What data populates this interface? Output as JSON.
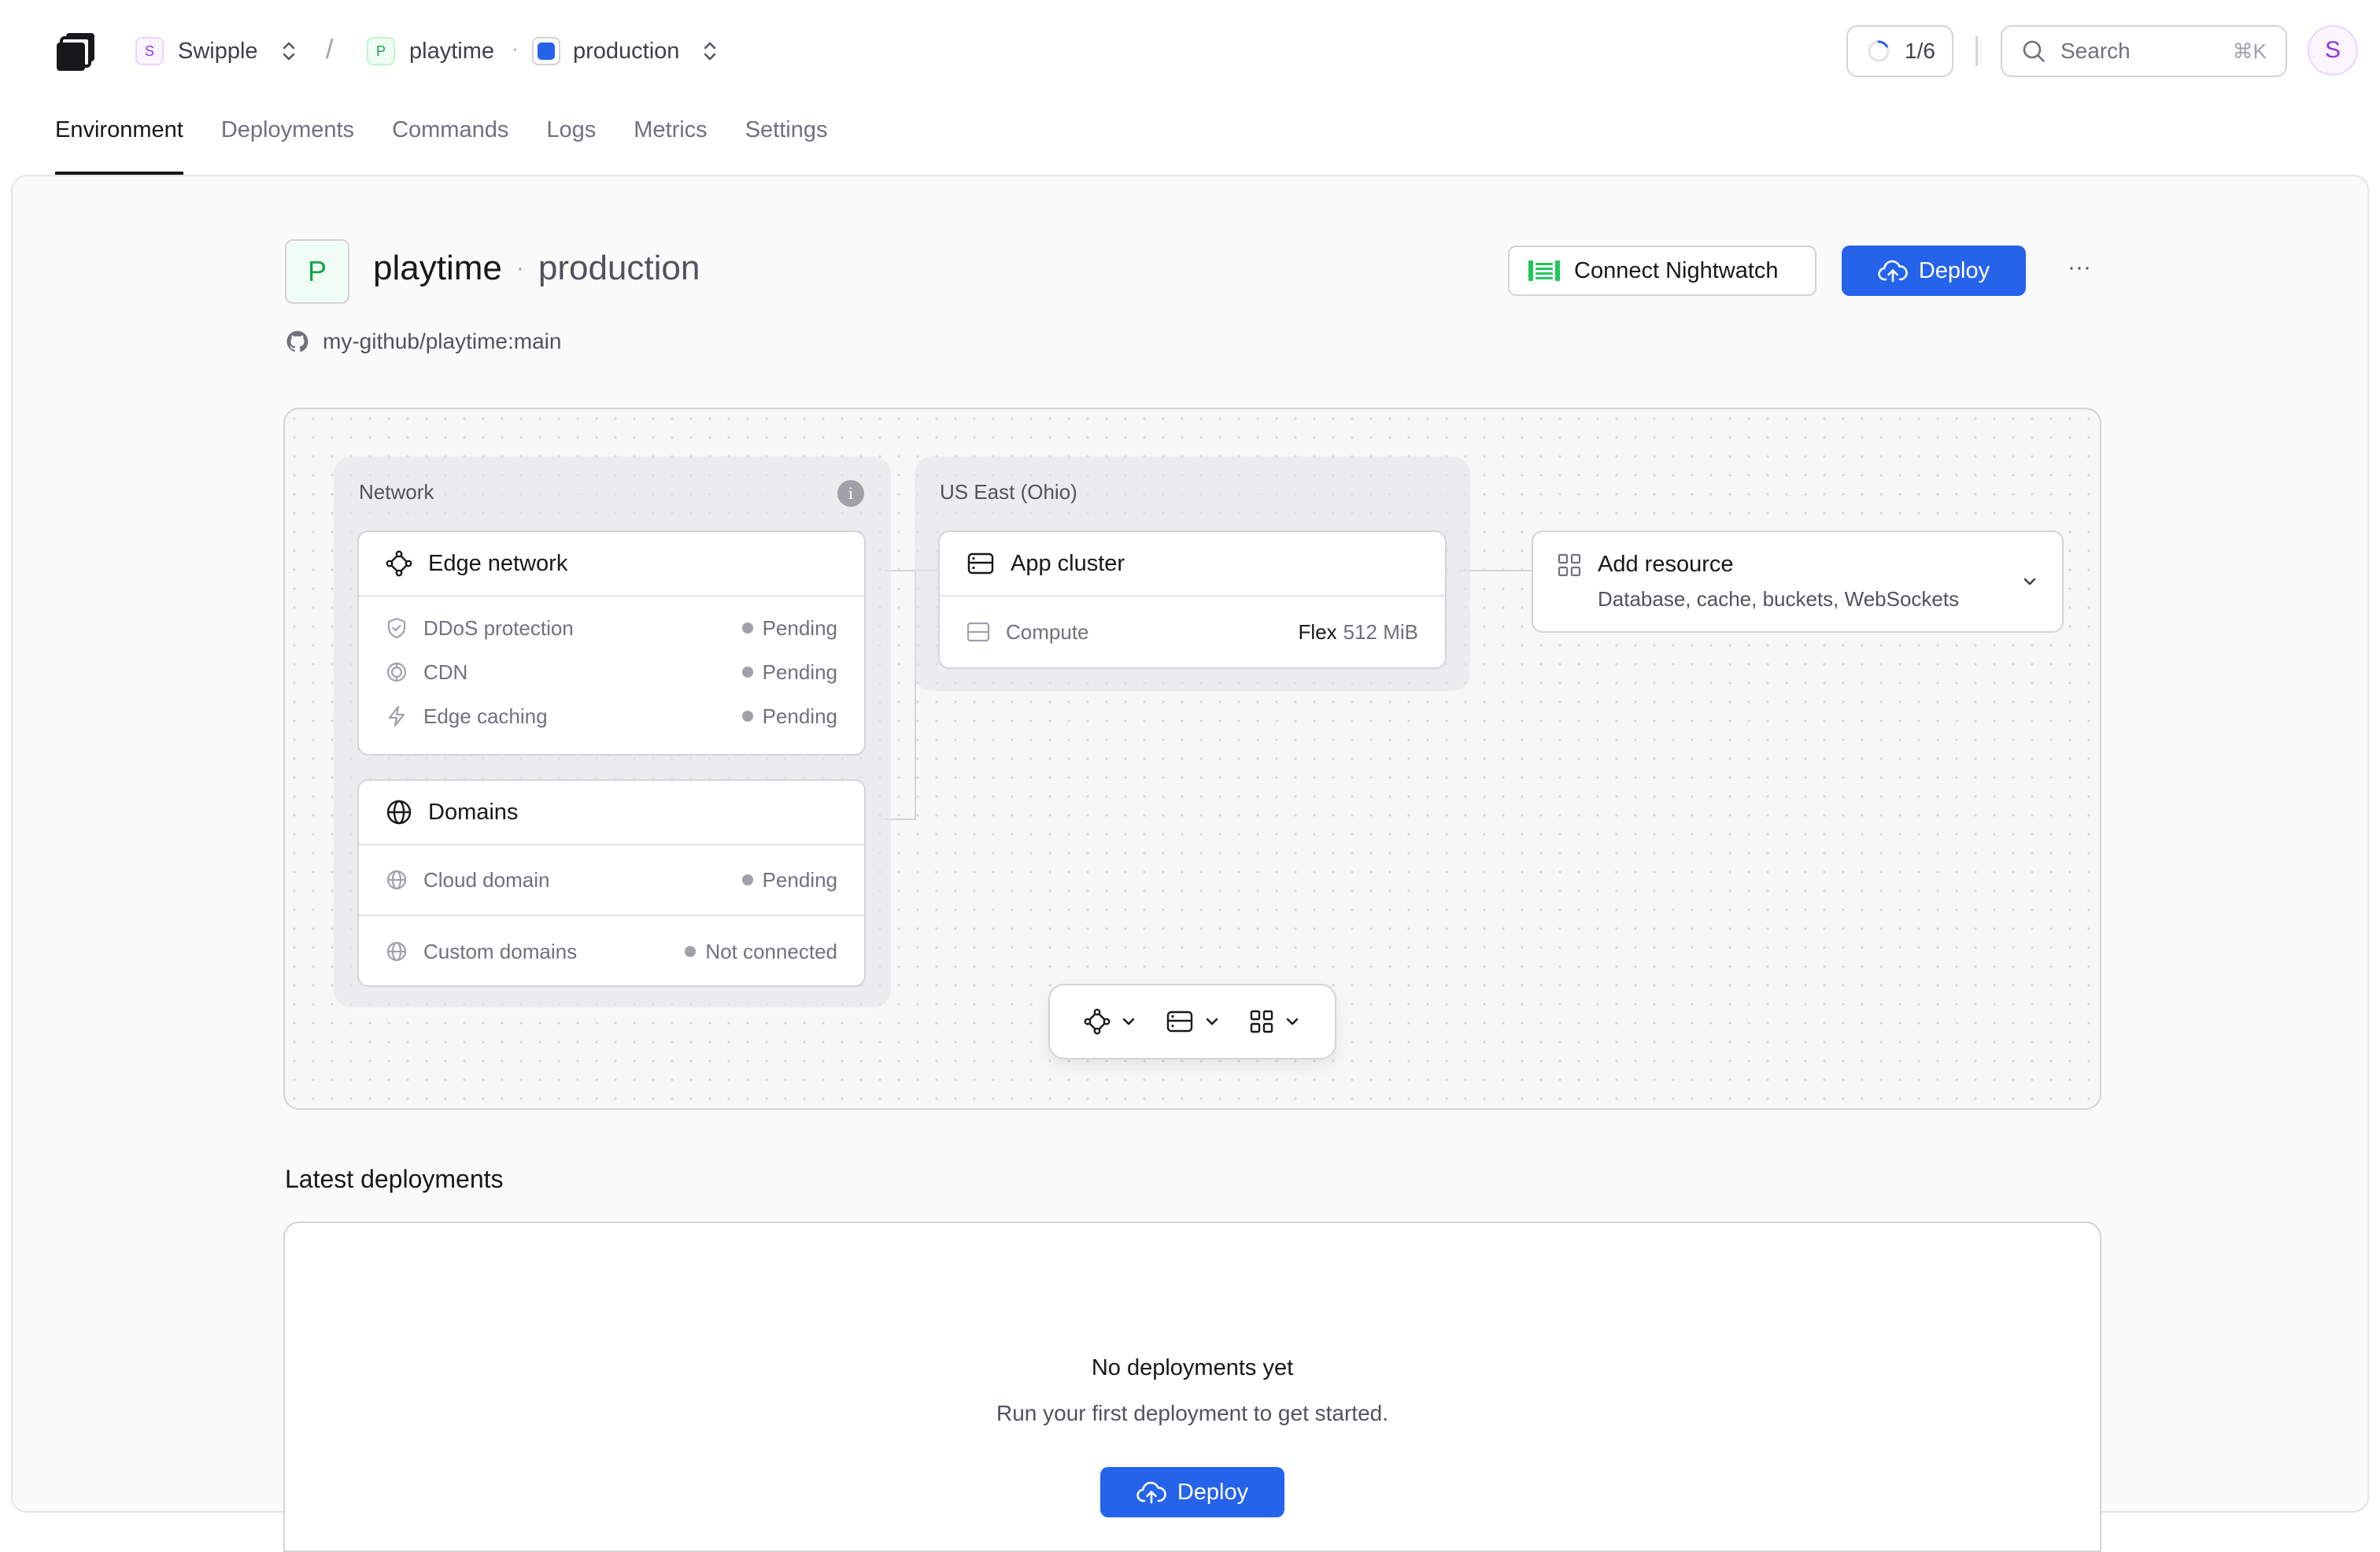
{
  "header": {
    "team": {
      "initial": "S",
      "name": "Swipple"
    },
    "separator": "/",
    "project": {
      "initial": "P",
      "name": "playtime"
    },
    "dot": "·",
    "environment": {
      "name": "production"
    },
    "progress": {
      "label": "1/6",
      "value_fraction": 0.1667
    },
    "search": {
      "placeholder": "Search",
      "shortcut": "⌘K"
    },
    "avatar_initial": "S"
  },
  "tabs": [
    {
      "label": "Environment",
      "active": true
    },
    {
      "label": "Deployments"
    },
    {
      "label": "Commands"
    },
    {
      "label": "Logs"
    },
    {
      "label": "Metrics"
    },
    {
      "label": "Settings"
    }
  ],
  "page": {
    "badge": "P",
    "project": "playtime",
    "dot": "·",
    "environment": "production",
    "repo": "my-github/playtime:main",
    "connect_button": "Connect Nightwatch",
    "deploy_button": "Deploy",
    "more": "···"
  },
  "canvas": {
    "network_group": {
      "label": "Network",
      "edge": {
        "title": "Edge network",
        "rows": [
          {
            "label": "DDoS protection",
            "status": "Pending",
            "icon": "shield-icon"
          },
          {
            "label": "CDN",
            "status": "Pending",
            "icon": "cdn-icon"
          },
          {
            "label": "Edge caching",
            "status": "Pending",
            "icon": "lightning-icon"
          }
        ]
      },
      "domains": {
        "title": "Domains",
        "rows": [
          {
            "label": "Cloud domain",
            "status": "Pending",
            "icon": "globe-icon"
          },
          {
            "label": "Custom domains",
            "status": "Not connected",
            "icon": "globe-icon"
          }
        ]
      }
    },
    "region_group": {
      "label": "US East (Ohio)",
      "cluster": {
        "title": "App cluster",
        "row": {
          "label": "Compute",
          "value_strong": "Flex",
          "value": "512 MiB"
        }
      }
    },
    "add_resource": {
      "title": "Add resource",
      "subtitle": "Database, cache, buckets, WebSockets"
    }
  },
  "deployments": {
    "title": "Latest deployments",
    "empty_title": "No deployments yet",
    "empty_text": "Run your first deployment to get started.",
    "button": "Deploy"
  },
  "colors": {
    "primary": "#2563eb",
    "accent_green": "#16a34a",
    "accent_purple": "#9333ea"
  }
}
